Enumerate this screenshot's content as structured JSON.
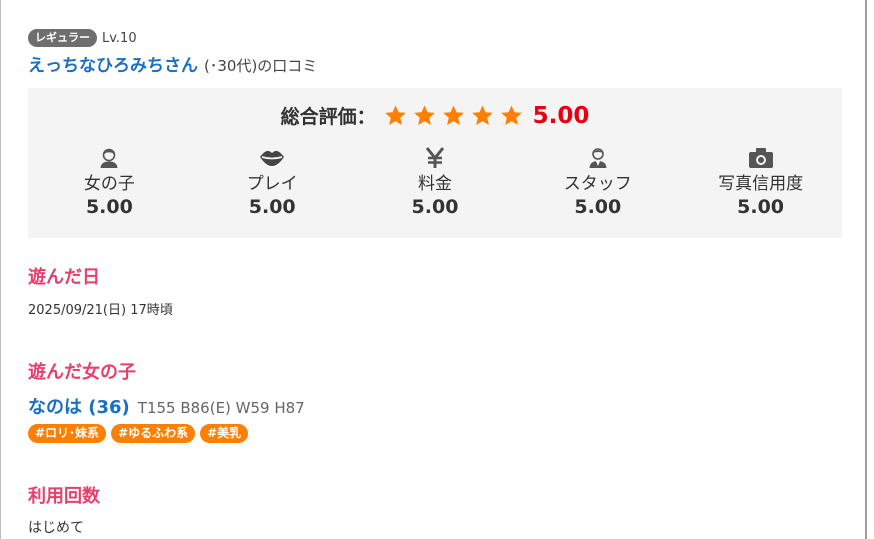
{
  "reviewer": {
    "rank_badge": "レギュラー",
    "level": "Lv.10",
    "name": "えっちなひろみちさん",
    "suffix": "(･30代)の口コミ"
  },
  "rating": {
    "overall_label": "総合評価：",
    "overall_score": "5.00",
    "stars_filled": 5,
    "stars_total": 5,
    "star_color": "#ff7f00",
    "score_color": "#e60012",
    "categories": [
      {
        "icon": "woman-icon",
        "label": "女の子",
        "score": "5.00"
      },
      {
        "icon": "lips-icon",
        "label": "プレイ",
        "score": "5.00"
      },
      {
        "icon": "yen-icon",
        "label": "料金",
        "score": "5.00"
      },
      {
        "icon": "staff-icon",
        "label": "スタッフ",
        "score": "5.00"
      },
      {
        "icon": "camera-icon",
        "label": "写真信用度",
        "score": "5.00"
      }
    ]
  },
  "visit_date": {
    "title": "遊んだ日",
    "value": "2025/09/21(日) 17時頃"
  },
  "girl": {
    "title": "遊んだ女の子",
    "name": "なのは (36)",
    "stats": "T155 B86(E) W59 H87",
    "tags": [
      "#ロリ･妹系",
      "#ゆるふわ系",
      "#美乳"
    ]
  },
  "visit_count": {
    "title": "利用回数",
    "value": "はじめて"
  },
  "colors": {
    "accent_pink": "#e83e6c",
    "link_blue": "#1a6fc4",
    "tag_orange": "#ff7f00",
    "panel_bg": "#f4f4f4"
  }
}
